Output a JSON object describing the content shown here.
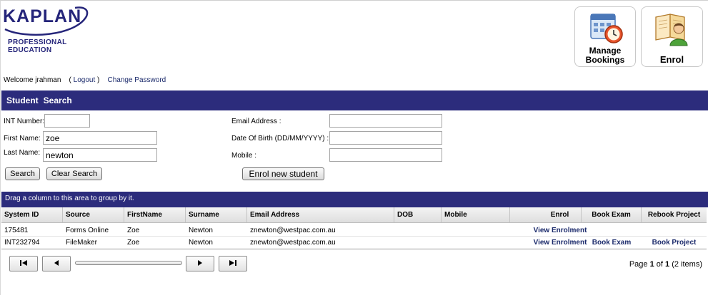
{
  "brand": {
    "name": "KAPLAN",
    "line1": "PROFESSIONAL",
    "line2": "EDUCATION",
    "color": "#25257a"
  },
  "tiles": {
    "manage_line1": "Manage",
    "manage_line2": "Bookings",
    "enrol": "Enrol"
  },
  "welcome": {
    "text": "Welcome jrahman",
    "open": "(",
    "logout": "Logout",
    "close": ")",
    "change_password": "Change Password"
  },
  "search": {
    "title_student": "Student",
    "title_search": "Search",
    "int_label": "INT Number:",
    "int_value": "",
    "first_label": "First Name:",
    "first_value": "zoe",
    "last_label": "Last Name:",
    "last_value": "newton",
    "email_label": "Email Address :",
    "email_value": "",
    "dob_label": "Date Of Birth (DD/MM/YYYY) :",
    "dob_value": "",
    "mobile_label": "Mobile :",
    "mobile_value": "",
    "search_btn": "Search",
    "clear_btn": "Clear Search",
    "enrol_btn": "Enrol new student"
  },
  "grid": {
    "group_hint": "Drag a column to this area to group by it.",
    "columns": [
      "System ID",
      "Source",
      "FirstName",
      "Surname",
      "Email Address",
      "DOB",
      "Mobile",
      "Enrol",
      "Book Exam",
      "Rebook Project"
    ],
    "rows": [
      {
        "system_id": "175481",
        "source": "Forms Online",
        "first": "Zoe",
        "surname": "Newton",
        "email": "znewton@westpac.com.au",
        "dob": "",
        "mobile": "",
        "enrol": "View Enrolment",
        "book_exam": "",
        "rebook": ""
      },
      {
        "system_id": "INT232794",
        "source": "FileMaker",
        "first": "Zoe",
        "surname": "Newton",
        "email": "znewton@westpac.com.au",
        "dob": "",
        "mobile": "",
        "enrol": "View Enrolment",
        "book_exam": "Book Exam",
        "rebook": "Book Project"
      }
    ],
    "pager": {
      "page_word": "Page",
      "current": "1",
      "of_word": "of",
      "total": "1",
      "items": "(2 items)"
    }
  },
  "colors": {
    "header_bar": "#2c2c7c",
    "link": "#1b2a6b"
  }
}
